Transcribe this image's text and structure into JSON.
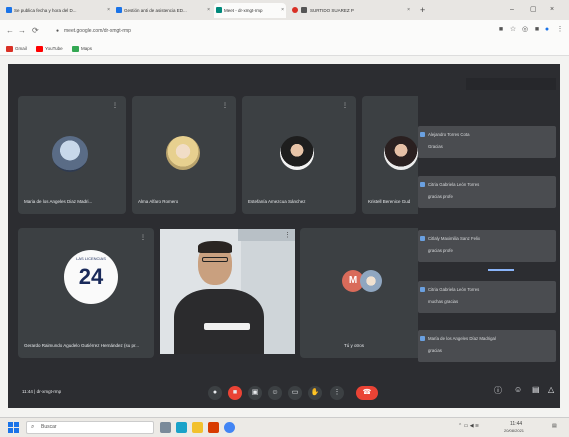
{
  "browser": {
    "tabs": [
      {
        "label": "Se publica fecha y hora del D...",
        "color": "#1a73e8"
      },
      {
        "label": "Gestión anti de asistencia ED...",
        "color": "#1a73e8"
      },
      {
        "label": "Meet - dr-xmgt-rmp",
        "color": "#00897b"
      },
      {
        "label": "SURTIDO SUAREZ P",
        "color": "#d93025"
      }
    ],
    "new_tab": "+",
    "url": "meet.google.com/dr-xmgt-rmp",
    "bookmarks": [
      {
        "label": "Gmail",
        "color": "#d93025"
      },
      {
        "label": "YouTube",
        "color": "#ff0000"
      },
      {
        "label": "Maps",
        "color": "#34a853"
      }
    ]
  },
  "meet": {
    "tiles": [
      {
        "name": "Maria de los Angeles Diaz Madri..."
      },
      {
        "name": "Alma Alfaro Romero"
      },
      {
        "name": "Estefanía Amezcua Sánchez"
      },
      {
        "name": "Kristell Berenice Gud"
      },
      {
        "name": "Gerardo Raimundo Agudelo Gutiérrez Hernández (su pr..."
      },
      {
        "name": "Tú y otros"
      }
    ],
    "logo_number": "24",
    "logo_caption": "LAS LICENCIAS",
    "chat": [
      {
        "sender": "Alejandro Torres Cota",
        "text": "Gracias"
      },
      {
        "sender": "Citria Gabriela León Torres",
        "text": "gracias profe"
      },
      {
        "sender": "Citlaly Maximilia Sanz Felix",
        "text": "gracias profe"
      },
      {
        "sender": "Citria Gabriela León Torres",
        "text": "muchas gracias"
      },
      {
        "sender": "María de los Angeles Díaz Madrigal",
        "text": "gracias"
      }
    ],
    "time_text": "11:44  |  dr-xmgt-rmp",
    "controls": [
      "mic-icon",
      "camera-off-icon",
      "captions-icon",
      "emoji-icon",
      "present-icon",
      "raise-hand-icon",
      "more-icon",
      "end-call-icon"
    ],
    "accent_red": "#ea4335"
  },
  "taskbar": {
    "search_placeholder": "Buscar",
    "clock": "11:44",
    "date": "20/08/2021"
  }
}
